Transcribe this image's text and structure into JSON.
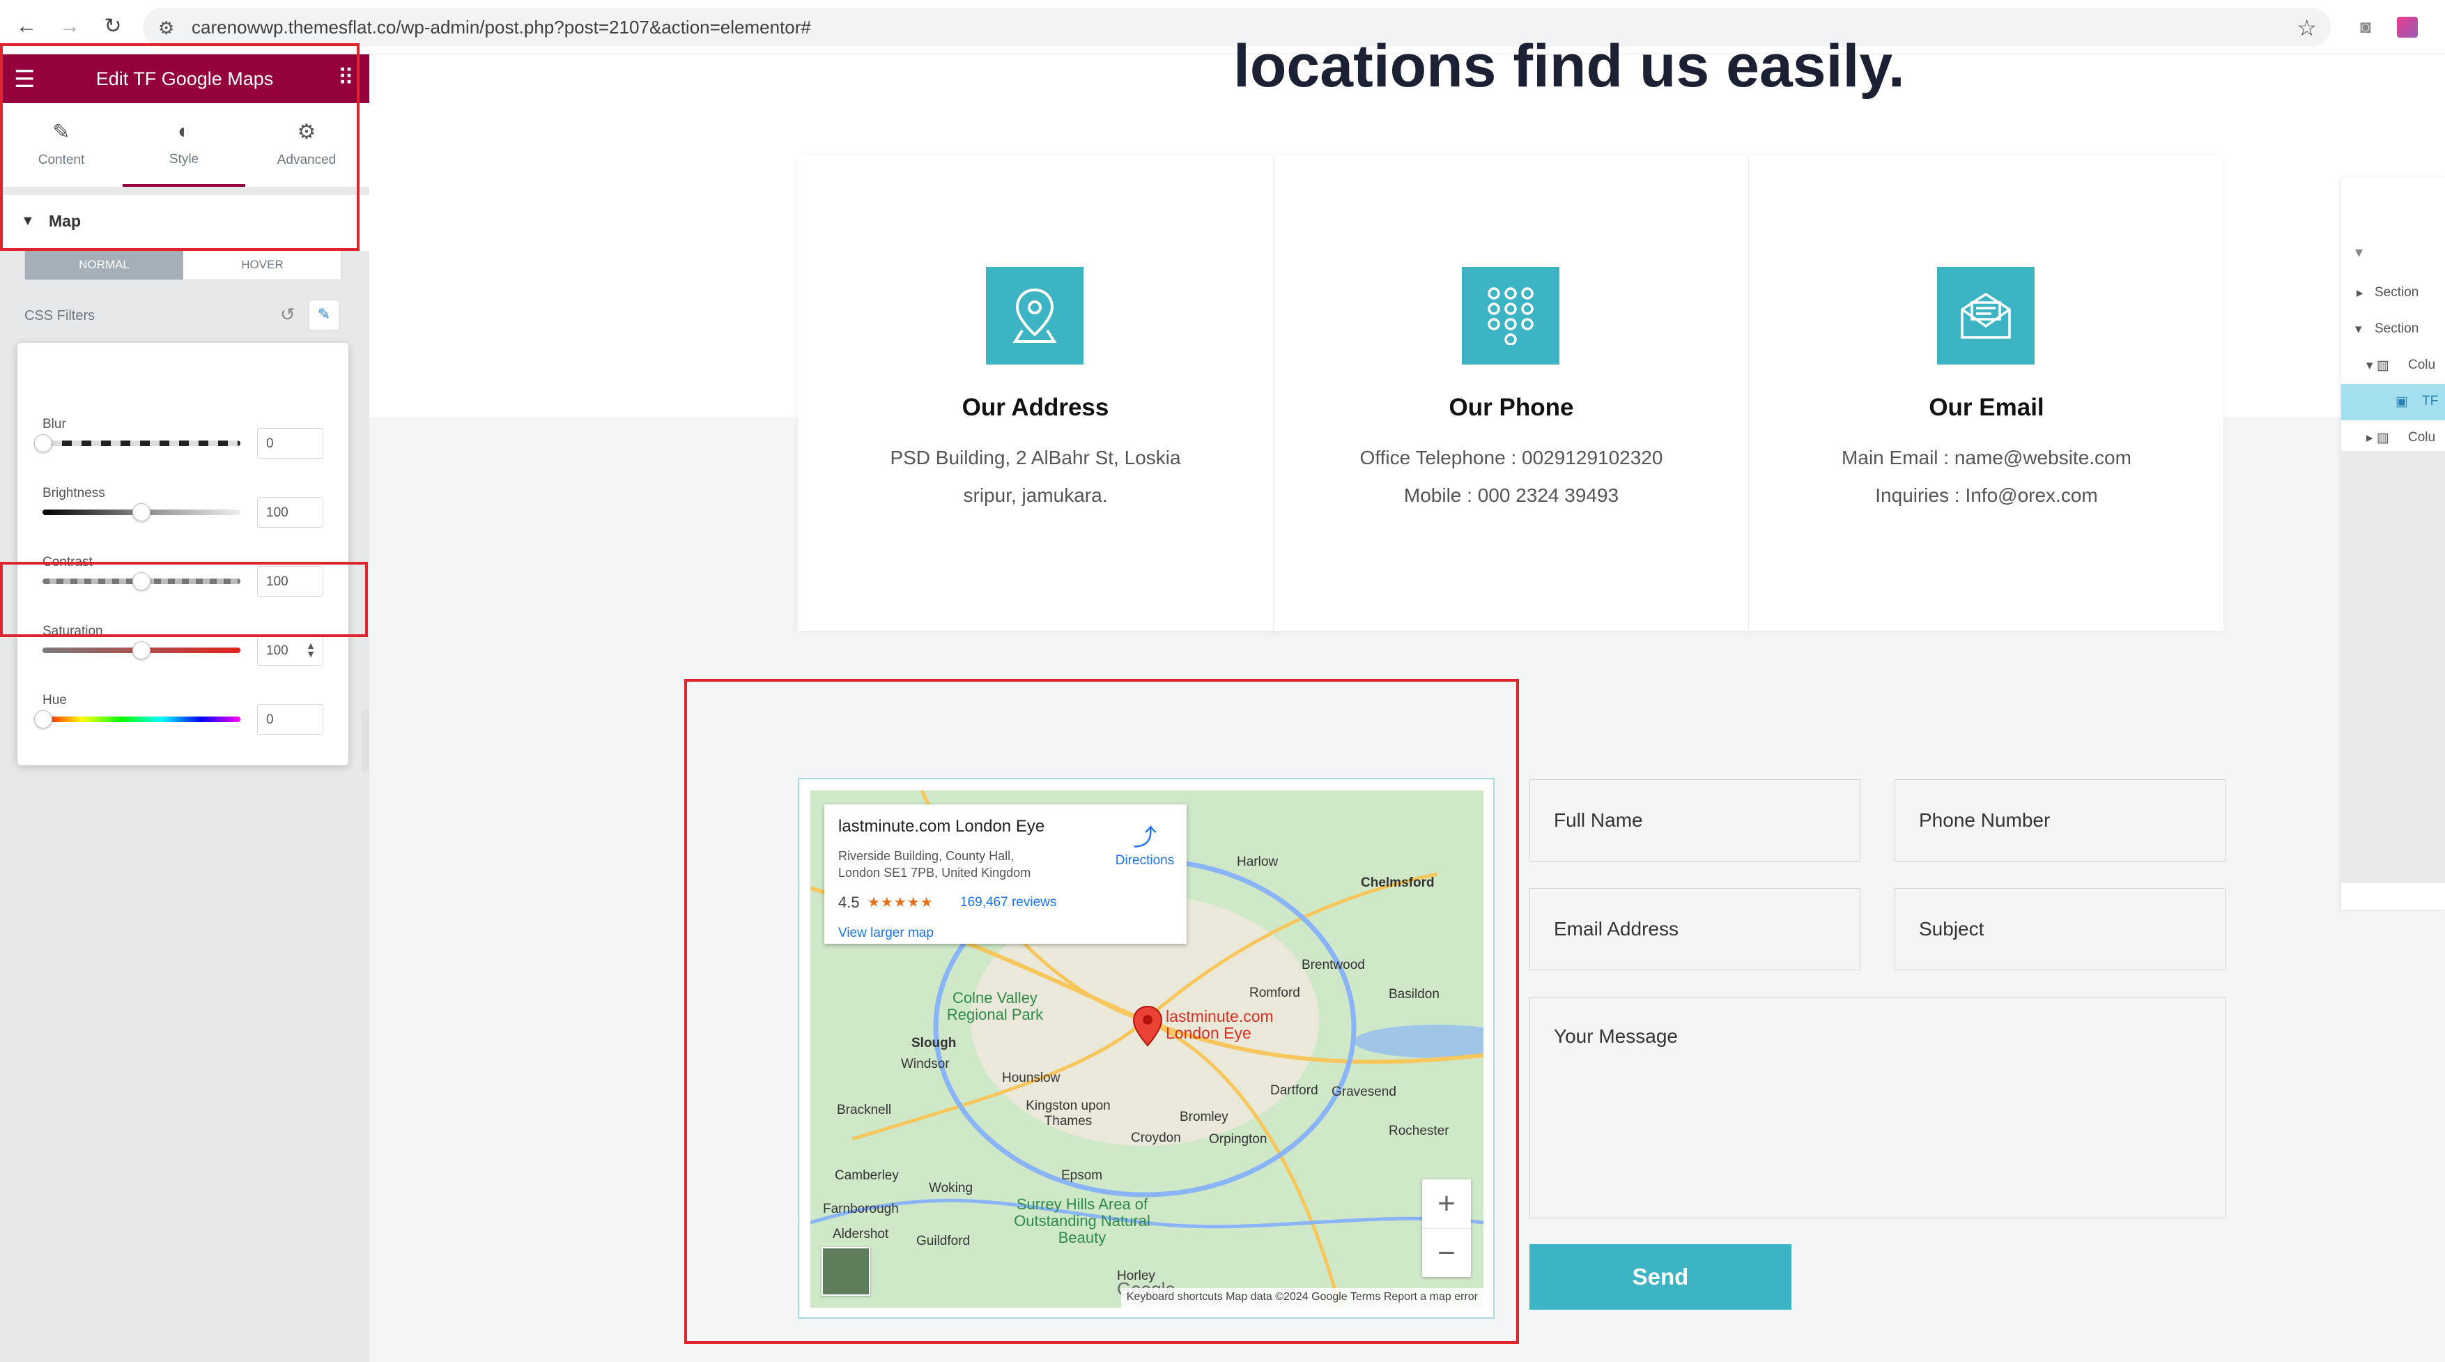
{
  "browser": {
    "url": "carenowwp.themesflat.co/wp-admin/post.php?post=2107&action=elementor#"
  },
  "panel": {
    "title": "Edit TF Google Maps",
    "tabs": [
      {
        "label": "Content",
        "icon": "pencil-icon"
      },
      {
        "label": "Style",
        "icon": "half-circle-icon"
      },
      {
        "label": "Advanced",
        "icon": "gear-icon"
      }
    ],
    "section_label": "Map",
    "states": [
      "NORMAL",
      "HOVER"
    ],
    "css_filters_label": "CSS Filters",
    "filters": [
      {
        "label": "Blur",
        "value": "0",
        "level": 0
      },
      {
        "label": "Brightness",
        "value": "100",
        "level": 0.5
      },
      {
        "label": "Contrast",
        "value": "100",
        "level": 0.5
      },
      {
        "label": "Saturation",
        "value": "100",
        "level": 0.5
      },
      {
        "label": "Hue",
        "value": "0",
        "level": 0
      }
    ]
  },
  "page": {
    "heading_cut": "locations find us easily.",
    "cards": [
      {
        "title": "Our Address",
        "line1": "PSD Building, 2 AlBahr St, Loskia",
        "line2": "sripur, jamukara.",
        "icon": "location-pin-icon"
      },
      {
        "title": "Our Phone",
        "line1": "Office Telephone : 0029129102320",
        "line2": "Mobile : 000 2324 39493",
        "icon": "keypad-icon"
      },
      {
        "title": "Our Email",
        "line1": "Main Email : name@website.com",
        "line2": "Inquiries : Info@orex.com",
        "icon": "envelope-icon"
      }
    ],
    "map": {
      "place_name": "lastminute.com London Eye",
      "address_line1": "Riverside Building, County Hall,",
      "address_line2": "London SE1 7PB, United Kingdom",
      "rating": "4.5",
      "stars": "★★★★★",
      "reviews": "169,467 reviews",
      "view_larger": "View larger map",
      "directions": "Directions",
      "pin_label_1": "lastminute.com",
      "pin_label_2": "London Eye",
      "google": "Google",
      "footer": "Keyboard shortcuts   Map data ©2024 Google   Terms   Report a map error",
      "places": [
        "Harlow",
        "Chelmsford",
        "Brentwood",
        "Romford",
        "Basildon",
        "Slough",
        "Windsor",
        "Hounslow",
        "Bracknell",
        "Kingston upon Thames",
        "Bromley",
        "Dartford",
        "Gravesend",
        "Croydon",
        "Orpington",
        "Rochester",
        "Camberley",
        "Woking",
        "Epsom",
        "Farnborough",
        "Aldershot",
        "Guildford",
        "Horley"
      ],
      "green_areas": [
        "Colne Valley Regional Park",
        "Surrey Hills Area of Outstanding Natural Beauty"
      ]
    },
    "form": {
      "full_name": "Full Name",
      "phone": "Phone Number",
      "email": "Email Address",
      "subject": "Subject",
      "message": "Your Message",
      "send": "Send"
    }
  },
  "navigator": {
    "items": [
      "Section",
      "Section",
      "Colu",
      "TF",
      "Colu"
    ]
  }
}
